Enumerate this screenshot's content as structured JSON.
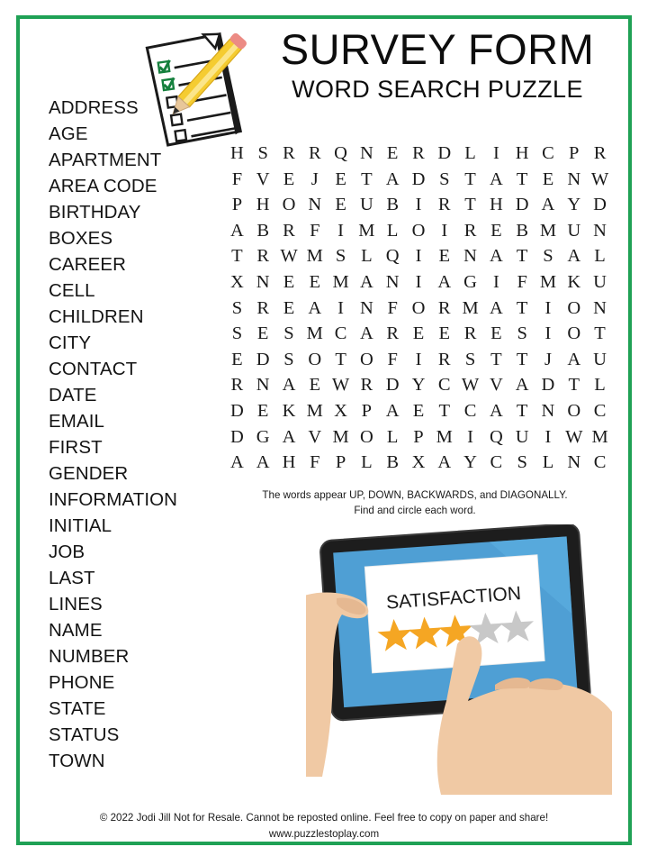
{
  "border_color": "#1fa155",
  "header": {
    "title": "SURVEY FORM",
    "subtitle": "WORD SEARCH PUZZLE",
    "clipboard_icon": "clipboard-checklist-pencil-icon"
  },
  "word_list": {
    "words": [
      "ADDRESS",
      "AGE",
      "APARTMENT",
      "AREA CODE",
      "BIRTHDAY",
      "BOXES",
      "CAREER",
      "CELL",
      "CHILDREN",
      "CITY",
      "CONTACT",
      "DATE",
      "EMAIL",
      "FIRST",
      "GENDER",
      "INFORMATION",
      "INITIAL",
      "JOB",
      "LAST",
      "LINES",
      "NAME",
      "NUMBER",
      "PHONE",
      "STATE",
      "STATUS",
      "TOWN"
    ]
  },
  "grid": {
    "rows": 14,
    "cols": 15,
    "letters": [
      [
        "H",
        "S",
        "R",
        "R",
        "Q",
        "N",
        "E",
        "R",
        "D",
        "L",
        "I",
        "H",
        "C",
        "P",
        "R"
      ],
      [
        "F",
        "V",
        "E",
        "J",
        "E",
        "T",
        "A",
        "D",
        "S",
        "T",
        "A",
        "T",
        "E",
        "N",
        "W"
      ],
      [
        "P",
        "H",
        "O",
        "N",
        "E",
        "U",
        "B",
        "I",
        "R",
        "T",
        "H",
        "D",
        "A",
        "Y",
        "D"
      ],
      [
        "A",
        "B",
        "R",
        "F",
        "I",
        "M",
        "L",
        "O",
        "I",
        "R",
        "E",
        "B",
        "M",
        "U",
        "N"
      ],
      [
        "T",
        "R",
        "W",
        "M",
        "S",
        "L",
        "Q",
        "I",
        "E",
        "N",
        "A",
        "T",
        "S",
        "A",
        "L"
      ],
      [
        "X",
        "N",
        "E",
        "E",
        "M",
        "A",
        "N",
        "I",
        "A",
        "G",
        "I",
        "F",
        "M",
        "K",
        "U"
      ],
      [
        "S",
        "R",
        "E",
        "A",
        "I",
        "N",
        "F",
        "O",
        "R",
        "M",
        "A",
        "T",
        "I",
        "O",
        "N"
      ],
      [
        "S",
        "E",
        "S",
        "M",
        "C",
        "A",
        "R",
        "E",
        "E",
        "R",
        "E",
        "S",
        "I",
        "O",
        "T"
      ],
      [
        "E",
        "D",
        "S",
        "O",
        "T",
        "O",
        "F",
        "I",
        "R",
        "S",
        "T",
        "T",
        "J",
        "A",
        "U"
      ],
      [
        "R",
        "N",
        "A",
        "E",
        "W",
        "R",
        "D",
        "Y",
        "C",
        "W",
        "V",
        "A",
        "D",
        "T",
        "L"
      ],
      [
        "D",
        "E",
        "K",
        "M",
        "X",
        "P",
        "A",
        "E",
        "T",
        "C",
        "A",
        "T",
        "N",
        "O",
        "C"
      ],
      [
        "D",
        "G",
        "A",
        "V",
        "M",
        "O",
        "L",
        "P",
        "M",
        "I",
        "Q",
        "U",
        "I",
        "W",
        "M"
      ],
      [
        "A",
        "A",
        "H",
        "F",
        "P",
        "L",
        "B",
        "X",
        "A",
        "Y",
        "C",
        "S",
        "L",
        "N",
        "C"
      ]
    ]
  },
  "instructions": {
    "line1": "The words appear UP, DOWN, BACKWARDS, and DIAGONALLY.",
    "line2": "Find and circle each word."
  },
  "illustration": {
    "name": "tablet-satisfaction-rating-illustration",
    "screen_text": "SATISFACTION",
    "stars_total": 5,
    "stars_filled": 3,
    "star_filled_color": "#f5a623",
    "star_empty_color": "#c8c8c8",
    "tablet_bezel_color": "#1d1d1d",
    "tablet_screen_color": "#4f9fd4",
    "hand_color": "#f0c9a4"
  },
  "footer": {
    "line1": "© 2022  Jodi Jill Not for Resale. Cannot be reposted online. Feel free to copy on paper and share!",
    "line2": "www.puzzlestoplay.com"
  }
}
